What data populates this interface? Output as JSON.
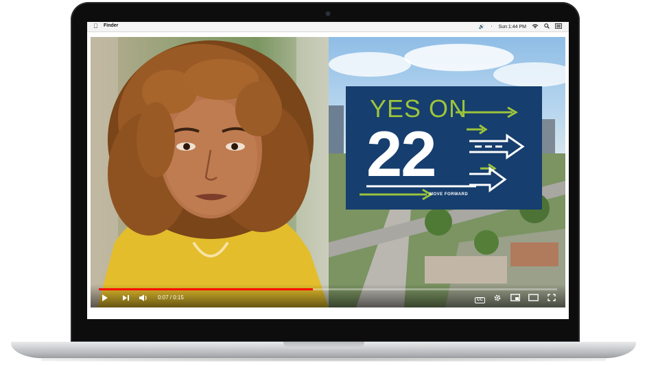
{
  "menubar": {
    "app_name": "Finder",
    "clock": "Sun 1:44 PM",
    "icons": [
      "apple-icon",
      "volume-icon",
      "bluetooth-icon",
      "wifi-icon",
      "search-icon",
      "list-icon"
    ]
  },
  "video": {
    "sign": {
      "line1": "YES ON",
      "number": "22",
      "tagline": "MOVE FORWARD"
    },
    "player": {
      "time": "0:07 / 0:15",
      "progress": 0.4667,
      "icons": [
        "play-icon",
        "next-icon",
        "volume-icon",
        "captions-icon",
        "settings-icon",
        "miniplayer-icon",
        "theater-icon",
        "fullscreen-icon"
      ],
      "captions_label": "CC"
    }
  },
  "colors": {
    "sign_blue": "#163e6e",
    "sign_green": "#9dc43b",
    "progress_red": "#ff0000"
  }
}
